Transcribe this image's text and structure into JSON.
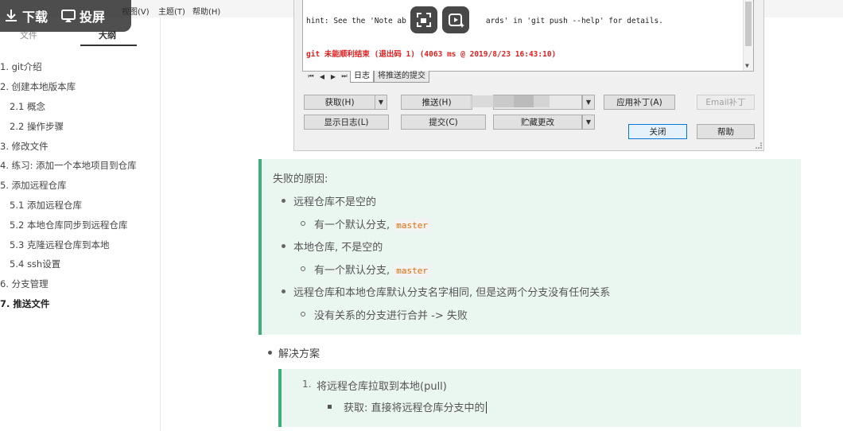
{
  "menubar": {
    "items": [
      "视图(V)",
      "主题(T)",
      "帮助(H)"
    ]
  },
  "overlay": {
    "download_label": "下载",
    "cast_label": "投屏"
  },
  "sidebar": {
    "tabs": [
      "文件",
      "大纲"
    ],
    "active_tab": "大纲",
    "outline": [
      {
        "label": "1. git介绍",
        "level": 1
      },
      {
        "label": "2. 创建本地版本库",
        "level": 1
      },
      {
        "label": "2.1 概念",
        "level": 2
      },
      {
        "label": "2.2 操作步骤",
        "level": 2
      },
      {
        "label": "3. 修改文件",
        "level": 1
      },
      {
        "label": "4. 练习: 添加一个本地项目到仓库",
        "level": 1
      },
      {
        "label": "5. 添加远程仓库",
        "level": 1
      },
      {
        "label": "5.1 添加远程仓库",
        "level": 2
      },
      {
        "label": "5.2 本地仓库同步到远程仓库",
        "level": 2
      },
      {
        "label": "5.3 克隆远程仓库到本地",
        "level": 2
      },
      {
        "label": "5.4 ssh设置",
        "level": 2
      },
      {
        "label": "6. 分支管理",
        "level": 1
      },
      {
        "label": "7. 推送文件",
        "level": 1,
        "active": true
      }
    ]
  },
  "dialog": {
    "hint_line_left": "hint: See the 'Note ab",
    "hint_line_right": "ards' in 'git push --help' for details.",
    "error_line": "git 未能顺利结束 (退出码 1) (4063 ms @ 2019/8/23 16:43:10)",
    "tabs": [
      "日志",
      "将推送的提交"
    ],
    "buttons": {
      "fetch": "获取(H)",
      "push": "推送(H)",
      "apply_patch": "应用补丁(A)",
      "email_patch": "Email补丁",
      "show_log": "显示日志(L)",
      "commit": "提交(C)",
      "stash": "贮藏更改",
      "close": "关闭",
      "help": "帮助"
    }
  },
  "content": {
    "note1": {
      "title": "失败的原因:",
      "items": [
        {
          "text": "远程仓库不是空的",
          "sub_text": "有一个默认分支, ",
          "sub_code": "master"
        },
        {
          "text": "本地仓库, 不是空的",
          "sub_text": "有一个默认分支, ",
          "sub_code": "master"
        },
        {
          "text": "远程仓库和本地仓库默认分支名字相同, 但是这两个分支没有任何关系",
          "sub_text": "没有关系的分支进行合并 -> 失败",
          "sub_code": ""
        }
      ]
    },
    "solution_label": "解决方案",
    "note2": {
      "number": "1.",
      "item": "将远程仓库拉取到本地(pull)",
      "sub_item": "获取: 直接将远程仓库分支中的"
    }
  },
  "colors": {
    "accent": "#3eaf7c",
    "note_bg": "#eaf6f0",
    "code_color": "#e96900",
    "error_red": "#e02020"
  }
}
